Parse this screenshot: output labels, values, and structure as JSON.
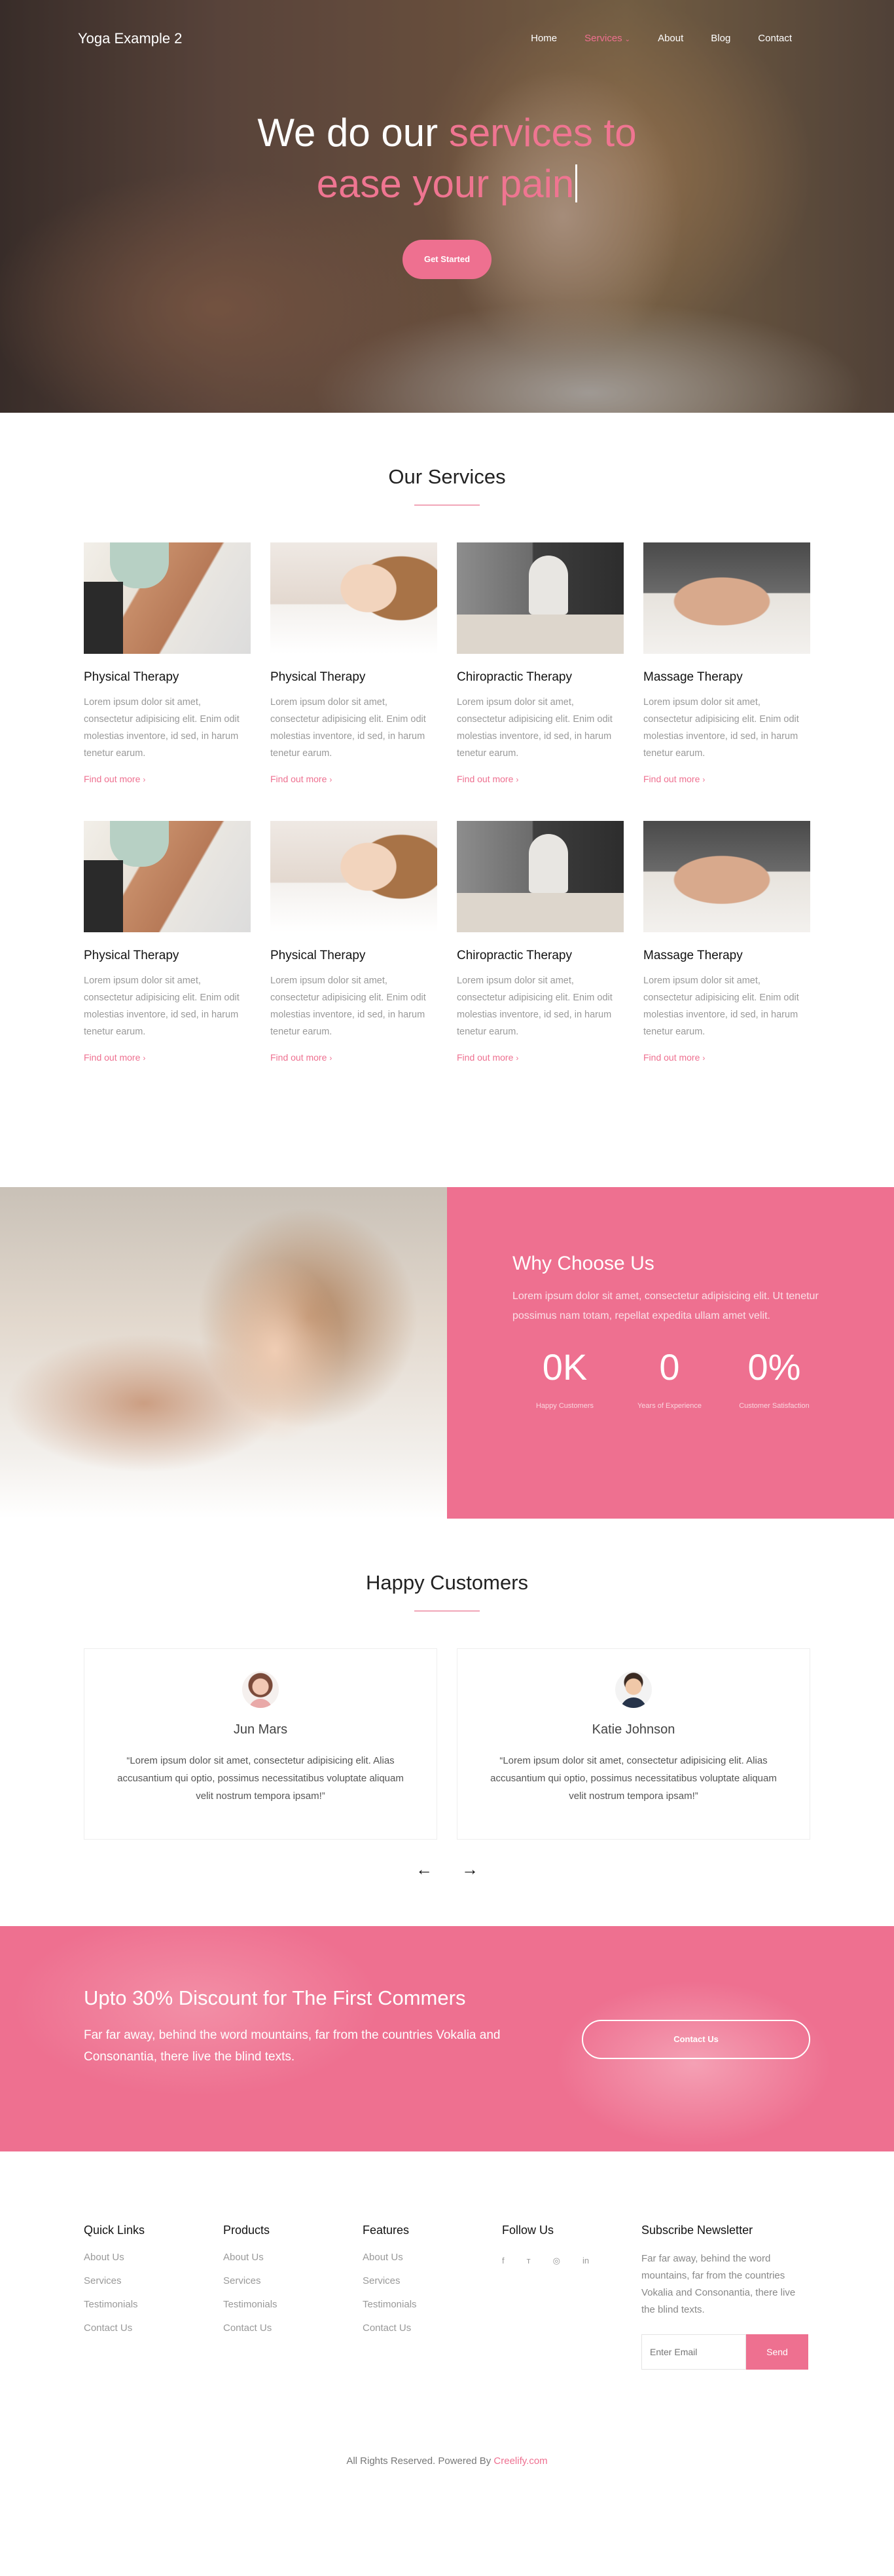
{
  "nav": {
    "brand": "Yoga Example 2",
    "items": [
      {
        "label": "Home",
        "active": false
      },
      {
        "label": "Services",
        "active": true
      },
      {
        "label": "About",
        "active": false
      },
      {
        "label": "Blog",
        "active": false
      },
      {
        "label": "Contact",
        "active": false
      }
    ]
  },
  "hero": {
    "title_plain": "We do our ",
    "title_accent_1": "services to",
    "title_accent_2": "ease your pain",
    "cta": "Get Started"
  },
  "services": {
    "title": "Our Services",
    "cards": [
      {
        "title": "Physical Therapy",
        "text": "Lorem ipsum dolor sit amet, consectetur adipisicing elit. Enim odit molestias inventore, id sed, in harum tenetur earum.",
        "link": "Find out more"
      },
      {
        "title": "Physical Therapy",
        "text": "Lorem ipsum dolor sit amet, consectetur adipisicing elit. Enim odit molestias inventore, id sed, in harum tenetur earum.",
        "link": "Find out more"
      },
      {
        "title": "Chiropractic Therapy",
        "text": "Lorem ipsum dolor sit amet, consectetur adipisicing elit. Enim odit molestias inventore, id sed, in harum tenetur earum.",
        "link": "Find out more"
      },
      {
        "title": "Massage Therapy",
        "text": "Lorem ipsum dolor sit amet, consectetur adipisicing elit. Enim odit molestias inventore, id sed, in harum tenetur earum.",
        "link": "Find out more"
      },
      {
        "title": "Physical Therapy",
        "text": "Lorem ipsum dolor sit amet, consectetur adipisicing elit. Enim odit molestias inventore, id sed, in harum tenetur earum.",
        "link": "Find out more"
      },
      {
        "title": "Physical Therapy",
        "text": "Lorem ipsum dolor sit amet, consectetur adipisicing elit. Enim odit molestias inventore, id sed, in harum tenetur earum.",
        "link": "Find out more"
      },
      {
        "title": "Chiropractic Therapy",
        "text": "Lorem ipsum dolor sit amet, consectetur adipisicing elit. Enim odit molestias inventore, id sed, in harum tenetur earum.",
        "link": "Find out more"
      },
      {
        "title": "Massage Therapy",
        "text": "Lorem ipsum dolor sit amet, consectetur adipisicing elit. Enim odit molestias inventore, id sed, in harum tenetur earum.",
        "link": "Find out more"
      }
    ]
  },
  "why": {
    "title": "Why Choose Us",
    "text": "Lorem ipsum dolor sit amet, consectetur adipisicing elit. Ut tenetur possimus nam totam, repellat expedita ullam amet velit.",
    "stats": [
      {
        "value": "0K",
        "label": "Happy Customers"
      },
      {
        "value": "0",
        "label": "Years of Experience"
      },
      {
        "value": "0%",
        "label": "Customer Satisfaction"
      }
    ]
  },
  "customers": {
    "title": "Happy Customers",
    "items": [
      {
        "name": "Jun Mars",
        "quote": "“Lorem ipsum dolor sit amet, consectetur adipisicing elit. Alias accusantium qui optio, possimus necessitatibus voluptate aliquam velit nostrum tempora ipsam!”"
      },
      {
        "name": "Katie Johnson",
        "quote": "“Lorem ipsum dolor sit amet, consectetur adipisicing elit. Alias accusantium qui optio, possimus necessitatibus voluptate aliquam velit nostrum tempora ipsam!”"
      }
    ],
    "prev": "←",
    "next": "→"
  },
  "discount": {
    "title": "Upto 30% Discount for The First Commers",
    "text": "Far far away, behind the word mountains, far from the countries Vokalia and Consonantia, there live the blind texts.",
    "cta": "Contact Us"
  },
  "footer": {
    "columns": [
      {
        "title": "Quick Links",
        "links": [
          "About Us",
          "Services",
          "Testimonials",
          "Contact Us"
        ]
      },
      {
        "title": "Products",
        "links": [
          "About Us",
          "Services",
          "Testimonials",
          "Contact Us"
        ]
      },
      {
        "title": "Features",
        "links": [
          "About Us",
          "Services",
          "Testimonials",
          "Contact Us"
        ]
      }
    ],
    "follow": {
      "title": "Follow Us",
      "icons": [
        {
          "name": "facebook-icon",
          "glyph": "f"
        },
        {
          "name": "twitter-icon",
          "glyph": "ᴛ"
        },
        {
          "name": "instagram-icon",
          "glyph": "◎"
        },
        {
          "name": "linkedin-icon",
          "glyph": "in"
        }
      ]
    },
    "newsletter": {
      "title": "Subscribe Newsletter",
      "text": "Far far away, behind the word mountains, far from the countries Vokalia and Consonantia, there live the blind texts.",
      "placeholder": "Enter Email",
      "button": "Send"
    },
    "copyright_prefix": "All Rights Reserved. Powered By ",
    "copyright_link": "Creelify.com"
  },
  "colors": {
    "accent": "#ee7090",
    "text_dark": "#111111",
    "text_muted": "#999999"
  }
}
